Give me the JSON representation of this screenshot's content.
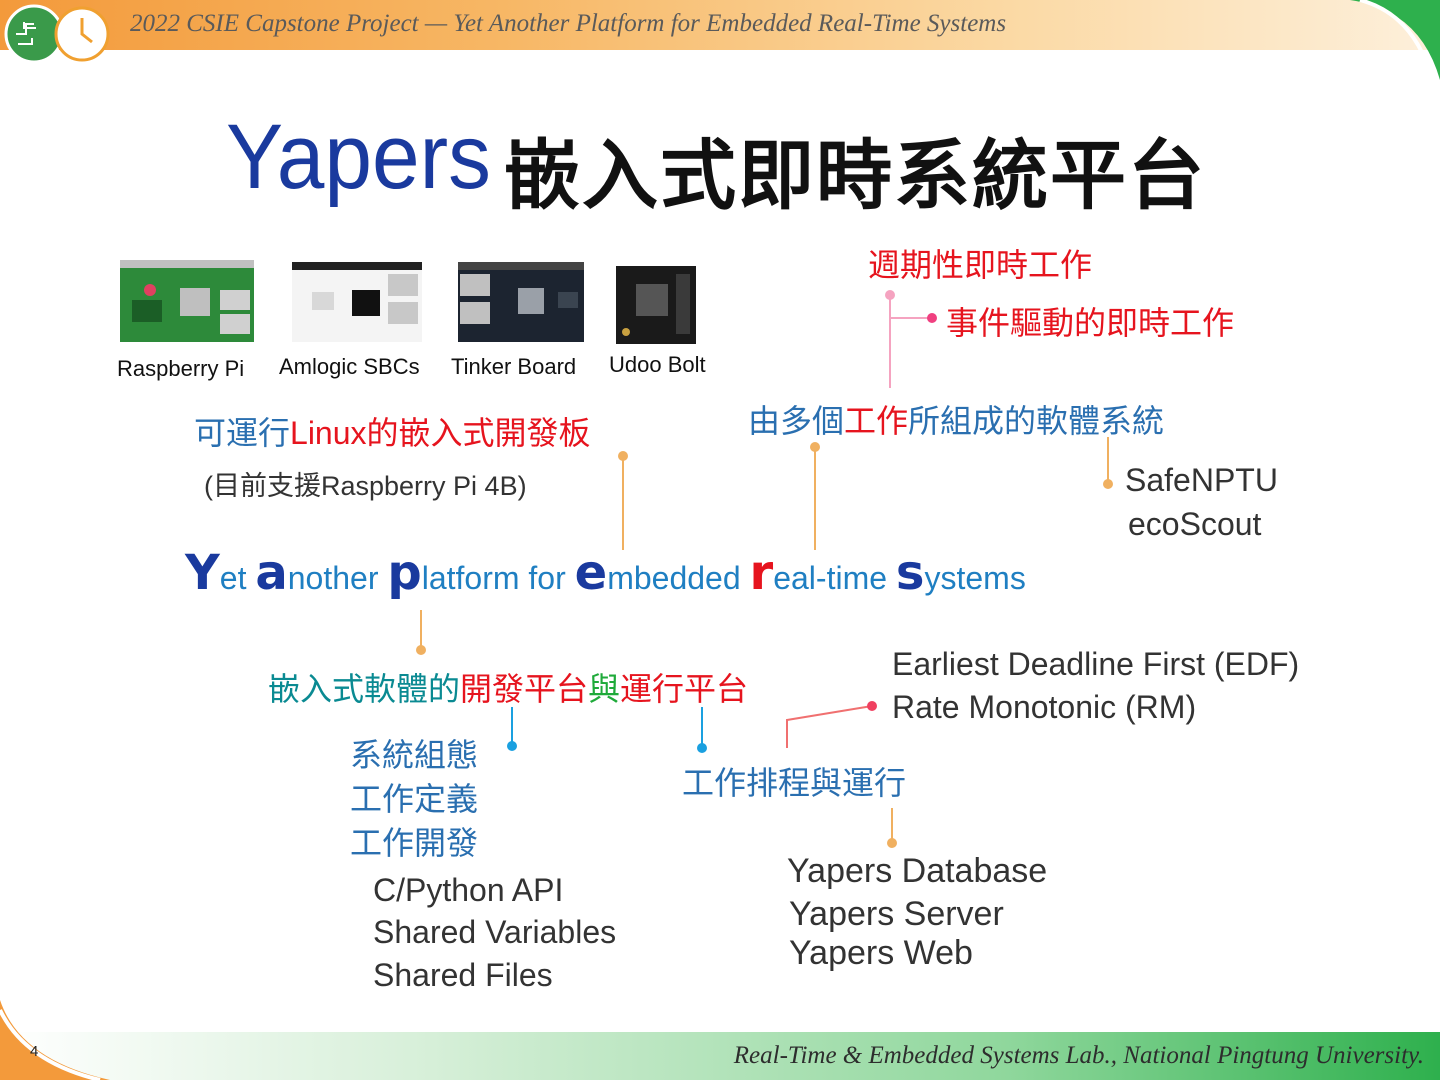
{
  "header": {
    "title": "2022 CSIE Capstone Project — Yet Another Platform for Embedded Real-Time Systems"
  },
  "title": {
    "logo_text": "Yapers",
    "cjk": "嵌入式即時系統平台"
  },
  "boards": [
    {
      "label": "Raspberry Pi"
    },
    {
      "label": "Amlogic SBCs"
    },
    {
      "label": "Tinker Board"
    },
    {
      "label": "Udoo Bolt"
    }
  ],
  "linux_boards": {
    "prefix": "可運行",
    "linux": "Linux",
    "suffix": "的嵌入式開發板",
    "support": "(目前支援Raspberry Pi 4B)"
  },
  "tasks": {
    "periodic": "週期性即時工作",
    "event": "事件驅動的即時工作",
    "system_prefix": "由多個",
    "system_work": "工作",
    "system_suffix": "所組成的軟體系統",
    "examples": [
      "SafeNPTU",
      "ecoScout"
    ]
  },
  "acronym": {
    "words": [
      {
        "initial": "Y",
        "rest": "et "
      },
      {
        "initial": "a",
        "rest": "nother "
      },
      {
        "initial": "p",
        "rest": "latform for "
      },
      {
        "initial": "e",
        "rest": "mbedded "
      },
      {
        "initial": "r",
        "rest": "eal-time "
      },
      {
        "initial": "s",
        "rest": "ystems"
      }
    ]
  },
  "platform": {
    "part1": "嵌入式軟體的",
    "part2": "開發平台",
    "part3": "與",
    "part4": "運行平台"
  },
  "dev_features": [
    "系統組態",
    "工作定義",
    "工作開發"
  ],
  "dev_tools": [
    "C/Python API",
    "Shared Variables",
    "Shared Files"
  ],
  "scheduling": {
    "label": "工作排程與運行",
    "algorithms": [
      "Earliest Deadline First (EDF)",
      "Rate Monotonic (RM)"
    ],
    "components": [
      "Yapers Database",
      "Yapers Server",
      "Yapers Web"
    ]
  },
  "footer": {
    "lab": "Real-Time & Embedded Systems Lab., National Pingtung University.",
    "page": "4"
  },
  "colors": {
    "header_orange": "#f39a3b",
    "footer_green": "#2eb04d",
    "text_blue": "#2a6fb0",
    "text_red": "#e6141e",
    "text_teal": "#0a8a92",
    "acronym_navy": "#1a3a9e",
    "line_orange": "#f0b060",
    "line_pink": "#f04080",
    "dot_cyan": "#1aa0e0"
  }
}
